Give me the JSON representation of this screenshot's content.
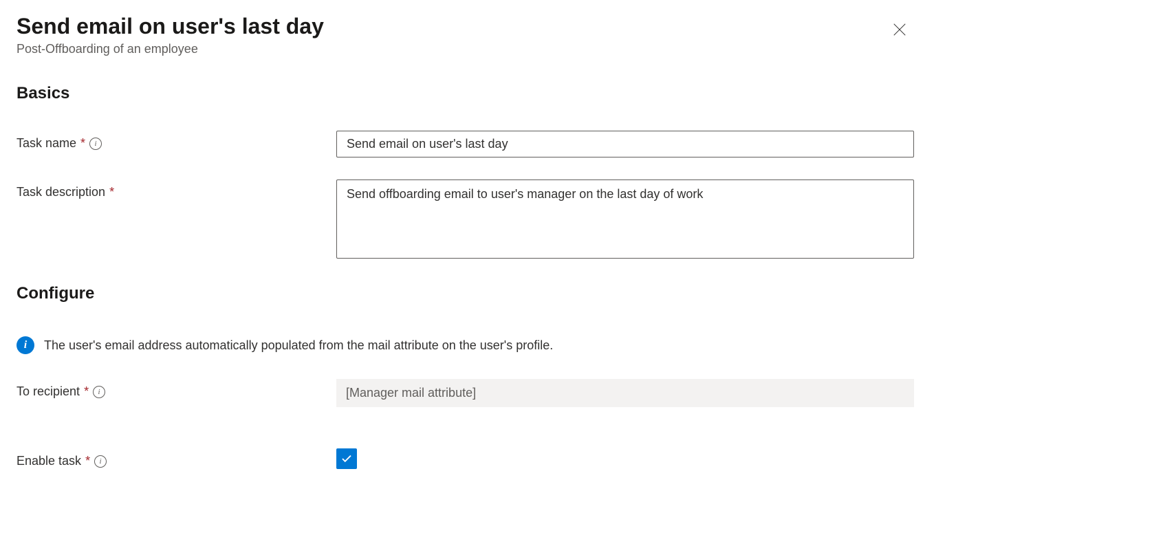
{
  "header": {
    "title": "Send email on user's last day",
    "subtitle": "Post-Offboarding of an employee"
  },
  "sections": {
    "basics": {
      "heading": "Basics",
      "fields": {
        "task_name": {
          "label": "Task name",
          "value": "Send email on user's last day"
        },
        "task_description": {
          "label": "Task description",
          "value": "Send offboarding email to user's manager on the last day of work"
        }
      }
    },
    "configure": {
      "heading": "Configure",
      "info_text": "The user's email address automatically populated from the mail attribute on the user's profile.",
      "fields": {
        "to_recipient": {
          "label": "To recipient",
          "value": "[Manager mail attribute]"
        },
        "enable_task": {
          "label": "Enable task",
          "checked": true
        }
      }
    }
  }
}
